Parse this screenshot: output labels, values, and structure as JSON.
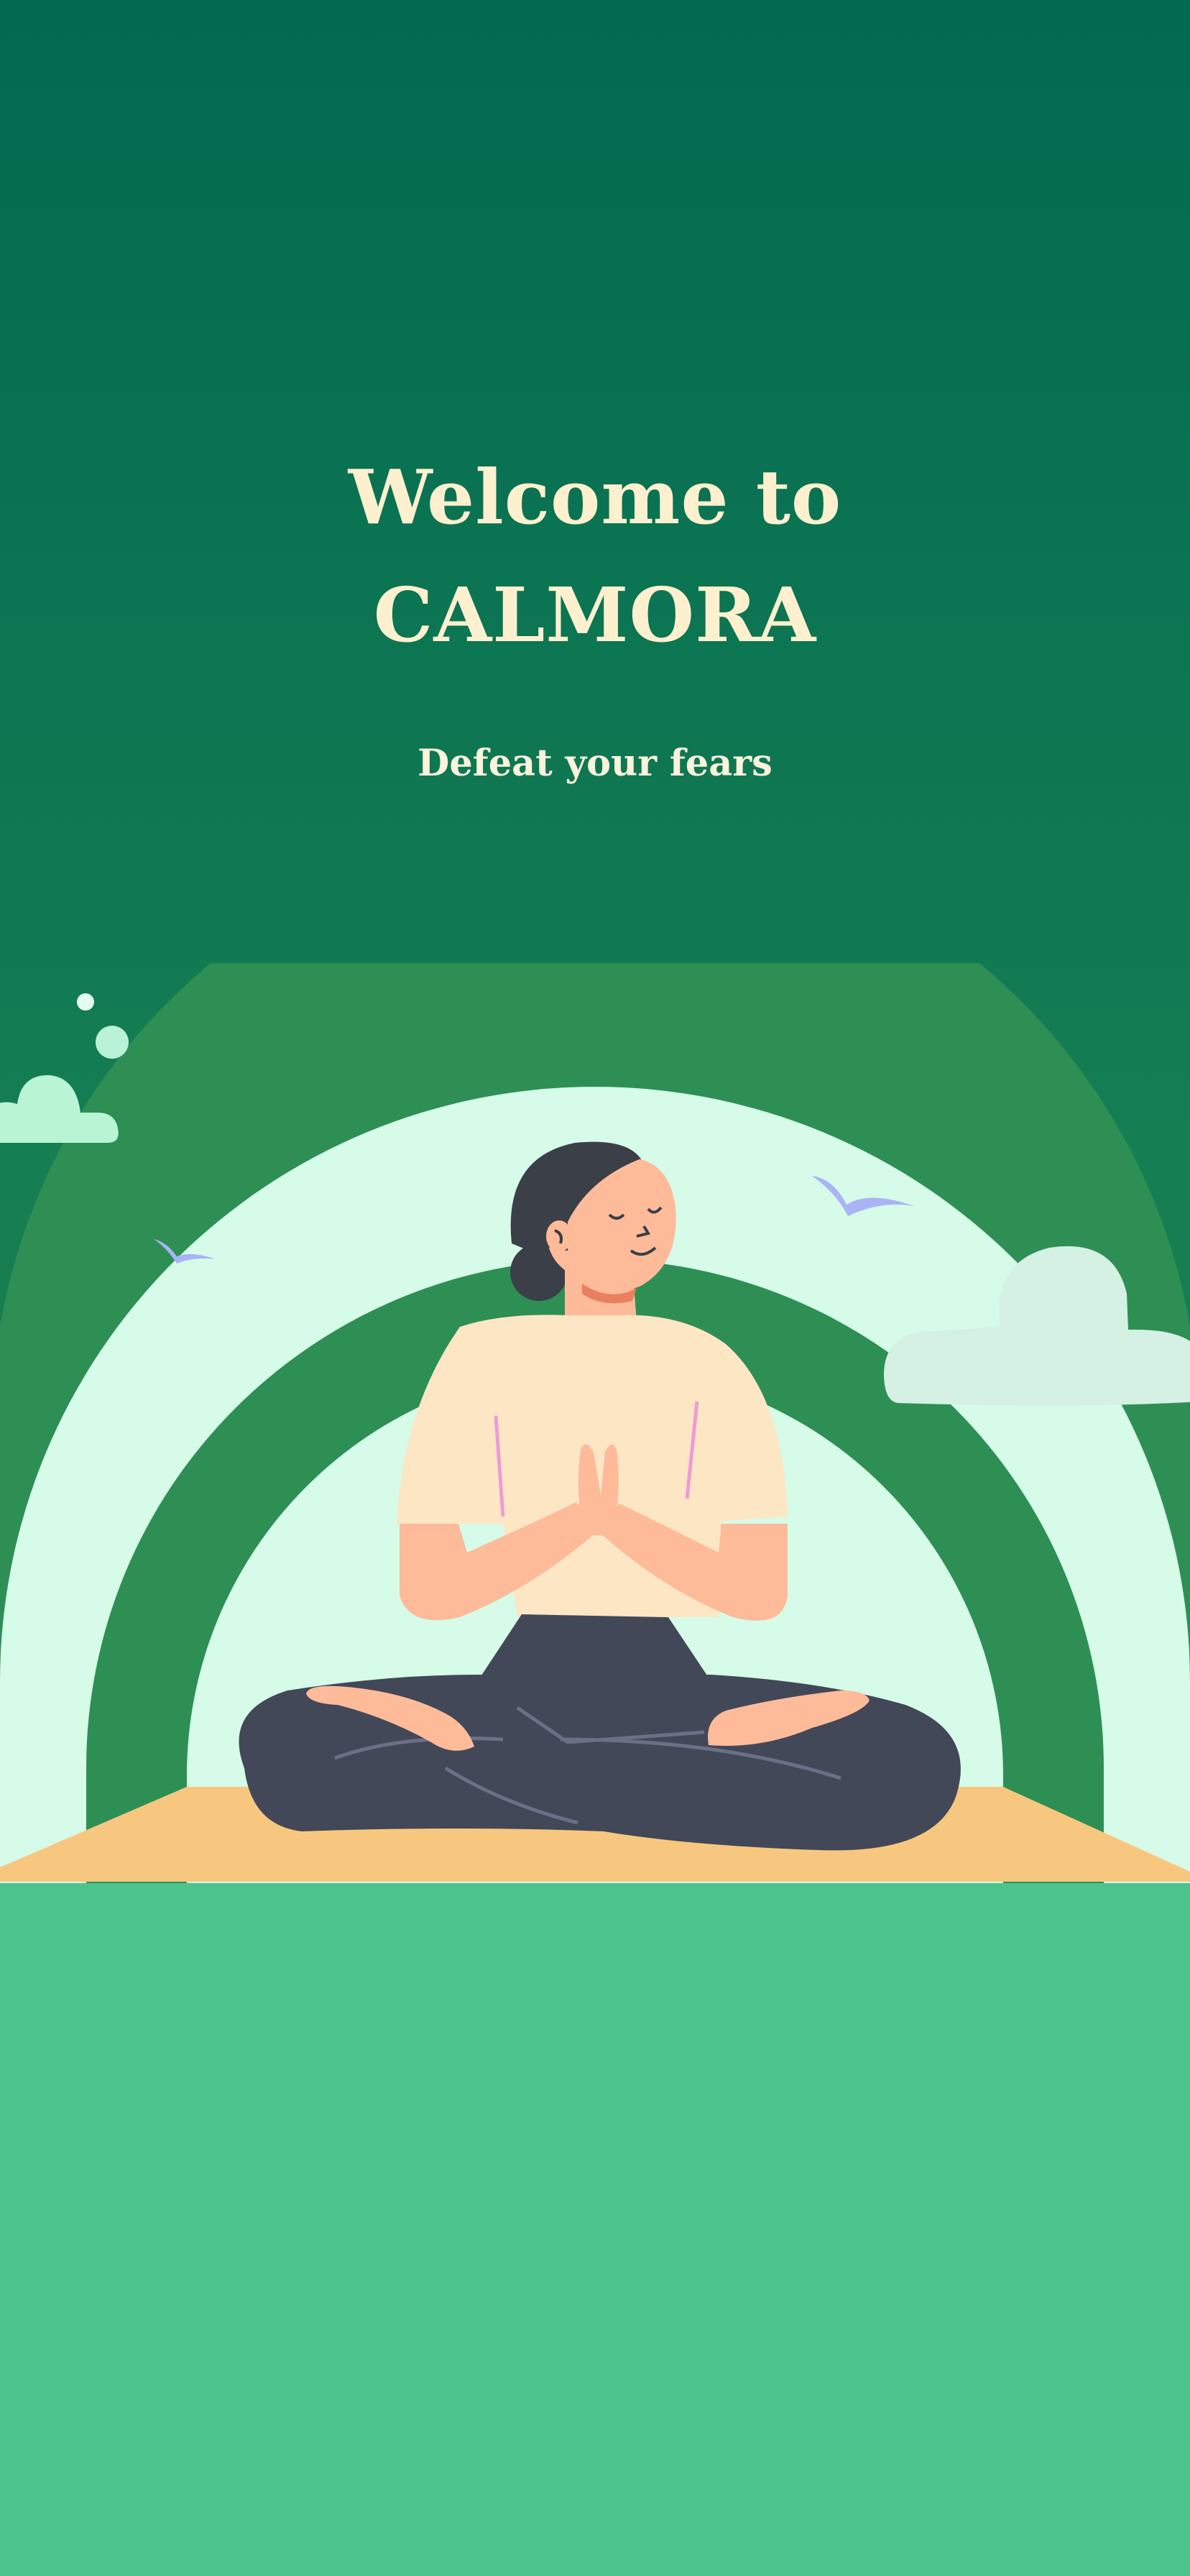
{
  "screen": {
    "title_line_1": "Welcome to",
    "title_line_2": "CALMORA",
    "subtitle": "Defeat your fears"
  },
  "illustration": {
    "subject": "meditating-woman-icon",
    "elements": [
      "rainbow-arch-icon",
      "cloud-icon",
      "bird-icon",
      "yoga-mat-icon",
      "bubble-icon"
    ]
  },
  "colors": {
    "background_top": "#026a50",
    "background_mid": "#1b7f50",
    "ground": "#4dc48c",
    "title": "#fdf0cf",
    "arch_dark": "#2e8f55",
    "arch_light": "#d6fbe8",
    "mat": "#f7c77f",
    "skin": "#fdbb9a",
    "shirt": "#fde6c4",
    "pants": "#424857",
    "hair": "#3a3f48",
    "bird": "#a9b3f5"
  }
}
